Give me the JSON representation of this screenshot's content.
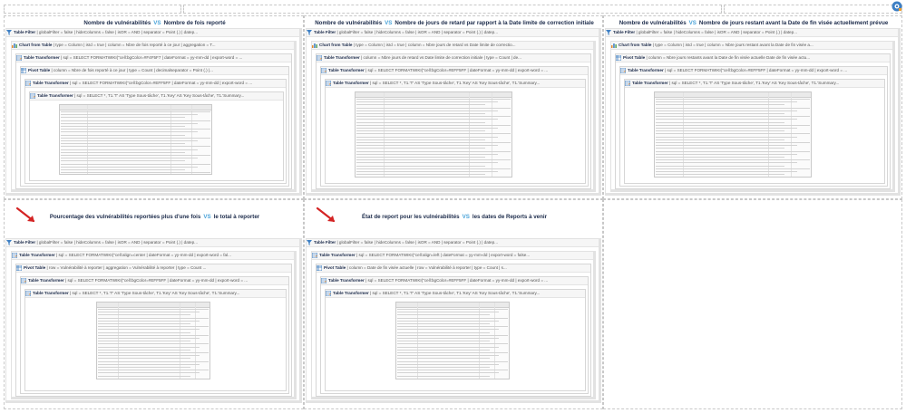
{
  "vs_label": "VS",
  "panels": [
    {
      "title_left": "Nombre de vulnérabilités",
      "title_right": "Nombre de fois reporté",
      "has_arrow": false,
      "headers": [
        {
          "name": "Table Filter",
          "detail": "| globalFilter = false | hideColumns = false | isOR = AND | separator = Point (.) | datep..."
        },
        {
          "name": "Chart from Table",
          "detail": "| type = Column | isId = true | column = Nbre de fois reporté à ce jour | aggregation = T..."
        },
        {
          "name": "Table Transformer",
          "detail": "| sql = SELECT FORMATWIKI(\"cell:bgColor=#F4F5F7 | dateFormat = yy-mm-dd | export-word = ..."
        },
        {
          "name": "Pivot Table",
          "detail": "| column = Nbre de fois reporté à ce jour | type = Count | decimalseparator = Point (.) |..."
        },
        {
          "name": "Table Transformer",
          "detail": "| sql = SELECT FORMATWIKI(\"cell:bgColor=#EFF5FF | dateFormat = yy-mm-dd | export-word = ..."
        },
        {
          "name": "Table Transformer",
          "detail": "| sql = SELECT *, T1.'T' AS 'Type Sous-tâche', T1.'Key' AS 'Key Sous-tâche', T1.'Summary..."
        }
      ]
    },
    {
      "title_left": "Nombre de vulnérabilités",
      "title_right": "Nombre de jours de retard par rapport à la Date limite de correction initiale",
      "has_arrow": false,
      "headers": [
        {
          "name": "Table Filter",
          "detail": "| globalFilter = false | hideColumns = false | isOR = AND | separator = Point (.) | datep..."
        },
        {
          "name": "Chart from Table",
          "detail": "| type = Column | isId = true | column = Nbre jours de retard vs Date limite de correctio..."
        },
        {
          "name": "Table Transformer",
          "detail": "| column = Nbre jours de retard vs Date limite de correction initiale | type = Count | de..."
        },
        {
          "name": "Table Transformer",
          "detail": "| sql = SELECT FORMATWIKI(\"cell:bgColor=#EFF5FF | dateFormat = yy-mm-dd | export-word = ..."
        },
        {
          "name": "Table Transformer",
          "detail": "| sql = SELECT *, T1.'T' AS 'Type Sous-tâche', T1.'Key' AS 'Key Sous-tâche', T1.'Summary..."
        }
      ]
    },
    {
      "title_left": "Nombre de vulnérabilités",
      "title_right": "Nombre de jours restant avant la Date de fin visée actuellement prévue",
      "has_arrow": false,
      "headers": [
        {
          "name": "Table Filter",
          "detail": "| globalFilter = false | hideColumns = false | isOR = AND | separator = Point (.) | datep..."
        },
        {
          "name": "Chart from Table",
          "detail": "| type = Column | isId = true | column = Nbre jours restant avant la Date de fin visée a..."
        },
        {
          "name": "Pivot Table",
          "detail": "| column = Nbre jours restants avant la Date de fin visée actuelle Date de fin visée actu..."
        },
        {
          "name": "Table Transformer",
          "detail": "| sql = SELECT FORMATWIKI(\"cell:bgColor=#EFF5FF | dateFormat = yy-mm-dd | export-word = ..."
        },
        {
          "name": "Table Transformer",
          "detail": "| sql = SELECT *, T1.'T' AS 'Type Sous-tâche', T1.'Key' AS 'Key Sous-tâche', T1.'Summary..."
        }
      ]
    },
    {
      "title_left": "Pourcentage des vulnérabilités reportées plus d'une fois",
      "title_right": "le total à reporter",
      "has_arrow": true,
      "headers": [
        {
          "name": "Table Filter",
          "detail": "| globalFilter = false | hideColumns = false | isOR = AND | separator = Point (.) | datep..."
        },
        {
          "name": "Table Transformer",
          "detail": "| sql = SELECT FORMATWIKI(\"cell:align=center | dateFormat = yy-mm-dd | export-word = fal..."
        },
        {
          "name": "Pivot Table",
          "detail": "| row = Vulnérabilité à reporter | aggregation = Vulnérabilité à reporter | type = Count ..."
        },
        {
          "name": "Table Transformer",
          "detail": "| sql = SELECT FORMATWIKI(\"cell:bgColor=#EFF5FF | dateFormat = yy-mm-dd | export-word = ..."
        },
        {
          "name": "Table Transformer",
          "detail": "| sql = SELECT *, T1.'T' AS 'Type Sous-tâche', T1.'Key' AS 'Key Sous-tâche', T1.'Summary..."
        }
      ]
    },
    {
      "title_left": "État de report pour les vulnérabilités",
      "title_right": "les dates de Reports à venir",
      "has_arrow": true,
      "headers": [
        {
          "name": "Table Filter",
          "detail": "| globalFilter = false | hideColumns = false | isOR = AND | separator = Point (.) | datep..."
        },
        {
          "name": "Table Transformer",
          "detail": "| sql = SELECT FORMATWIKI(\"cell:align=left | dateFormat = yy-mm-dd | export-word = false..."
        },
        {
          "name": "Pivot Table",
          "detail": "| column = Date de fin visée actuelle | row = Vulnérabilité à reporter | type = Count | s..."
        },
        {
          "name": "Table Transformer",
          "detail": "| sql = SELECT FORMATWIKI(\"cell:bgColor=#EFF5FF | dateFormat = yy-mm-dd | export-word = ..."
        },
        {
          "name": "Table Transformer",
          "detail": "| sql = SELECT *, T1.'T' AS 'Type Sous-tâche', T1.'Key' AS 'Key Sous-tâche', T1.'Summary..."
        }
      ]
    }
  ],
  "thumb_columns": [
    "Type / Key",
    "Summary",
    "Assignee",
    "Reporter"
  ]
}
